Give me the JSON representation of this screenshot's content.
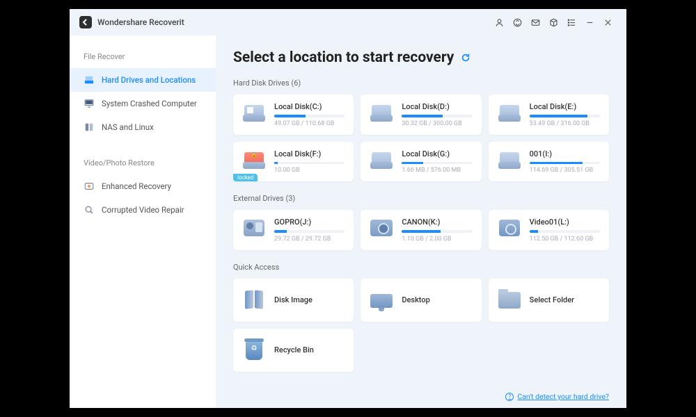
{
  "app": {
    "title": "Wondershare Recoverit"
  },
  "sidebar": {
    "section1": "File Recover",
    "section2": "Video/Photo Restore",
    "items": {
      "hdd": {
        "label": "Hard Drives and Locations"
      },
      "crash": {
        "label": "System Crashed Computer"
      },
      "nas": {
        "label": "NAS and Linux"
      },
      "enh": {
        "label": "Enhanced Recovery"
      },
      "cvr": {
        "label": "Corrupted Video Repair"
      }
    }
  },
  "main": {
    "heading": "Select a location to start recovery",
    "sections": {
      "hdd": "Hard Disk Drives (6)",
      "ext": "External Drives (3)",
      "qa": "Quick Access"
    }
  },
  "drives": {
    "c": {
      "name": "Local Disk(C:)",
      "size": "49.07 GB / 110.68 GB",
      "pct": 44
    },
    "d": {
      "name": "Local Disk(D:)",
      "size": "30.32 GB / 300.00 GB",
      "pct": 58
    },
    "e": {
      "name": "Local Disk(E:)",
      "size": "53.49 GB / 316.00 GB",
      "pct": 82
    },
    "f": {
      "name": "Local Disk(F:)",
      "size": "10.00 GB",
      "pct": 5,
      "locked": true,
      "tag": "locked"
    },
    "g": {
      "name": "Local Disk(G:)",
      "size": "1.66 MB / 576.00 MB",
      "pct": 30
    },
    "i": {
      "name": "001(I:)",
      "size": "114.69 GB / 305.51 GB",
      "pct": 75
    }
  },
  "external": {
    "j": {
      "name": "GOPRO(J:)",
      "size": "29.72 GB / 29.72 GB",
      "pct": 18
    },
    "k": {
      "name": "CANON(K:)",
      "size": "1.10 GB / 2.00 GB",
      "pct": 55
    },
    "l": {
      "name": "Video01(L:)",
      "size": "112.50 GB / 112.60 GB",
      "pct": 12
    }
  },
  "quick": {
    "diskimage": {
      "name": "Disk Image"
    },
    "desktop": {
      "name": "Desktop"
    },
    "folder": {
      "name": "Select Folder"
    },
    "recycle": {
      "name": "Recycle Bin"
    }
  },
  "footer": {
    "help": "Can't detect your hard drive?"
  }
}
